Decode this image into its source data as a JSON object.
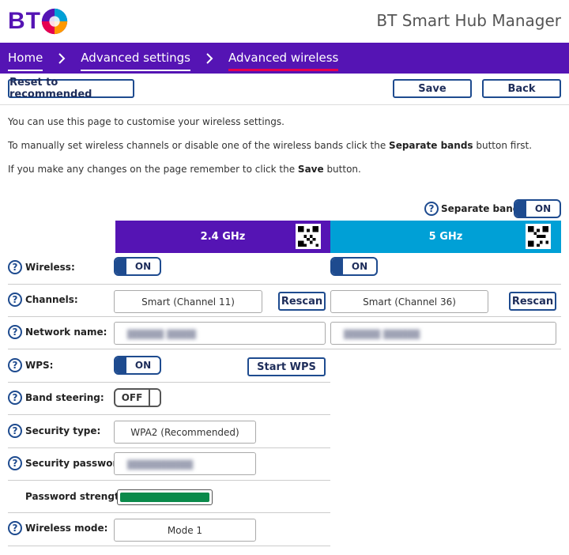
{
  "header": {
    "logo_text": "BT",
    "app_title": "BT Smart Hub Manager"
  },
  "breadcrumb": {
    "items": [
      "Home",
      "Advanced settings",
      "Advanced wireless"
    ]
  },
  "toolbar": {
    "reset_label": "Reset to recommended",
    "save_label": "Save",
    "back_label": "Back"
  },
  "intro": {
    "line1": "You can use this page to customise your wireless settings.",
    "line2_prefix": "To manually set wireless channels or disable one of the wireless bands click the ",
    "line2_bold": "Separate bands",
    "line2_suffix": " button first.",
    "line3_prefix": "If you make any changes on the page remember to click the ",
    "line3_bold": "Save",
    "line3_suffix": " button."
  },
  "separate_bands": {
    "label": "Separate bands",
    "state": "ON"
  },
  "bands": {
    "band1": "2.4 GHz",
    "band2": "5 GHz",
    "band1_color": "#5514b4",
    "band2_color": "#00a0d6"
  },
  "rows": {
    "wireless": {
      "label": "Wireless:",
      "band1": "ON",
      "band2": "ON"
    },
    "channels": {
      "label": "Channels:",
      "band1": "Smart (Channel 11)",
      "band2": "Smart (Channel 36)",
      "rescan": "Rescan"
    },
    "network_name": {
      "label": "Network name:"
    },
    "wps": {
      "label": "WPS:",
      "state": "ON",
      "start": "Start WPS"
    },
    "band_steering": {
      "label": "Band steering:",
      "state": "OFF"
    },
    "security_type": {
      "label": "Security type:",
      "value": "WPA2 (Recommended)"
    },
    "security_password": {
      "label": "Security password:"
    },
    "password_strength": {
      "label": "Password strength:",
      "level": 1.0,
      "color": "#0a8a4a"
    },
    "wireless_mode": {
      "label": "Wireless mode:",
      "value": "Mode 1"
    }
  },
  "colors": {
    "brand_purple": "#5514b4",
    "accent_blue": "#1e4b8f",
    "band_blue": "#00a0d6",
    "nav_active_underline": "#e60050"
  },
  "icons": {
    "help": "?",
    "qr": "qr-code-icon",
    "chevron": "chevron-right-icon"
  }
}
